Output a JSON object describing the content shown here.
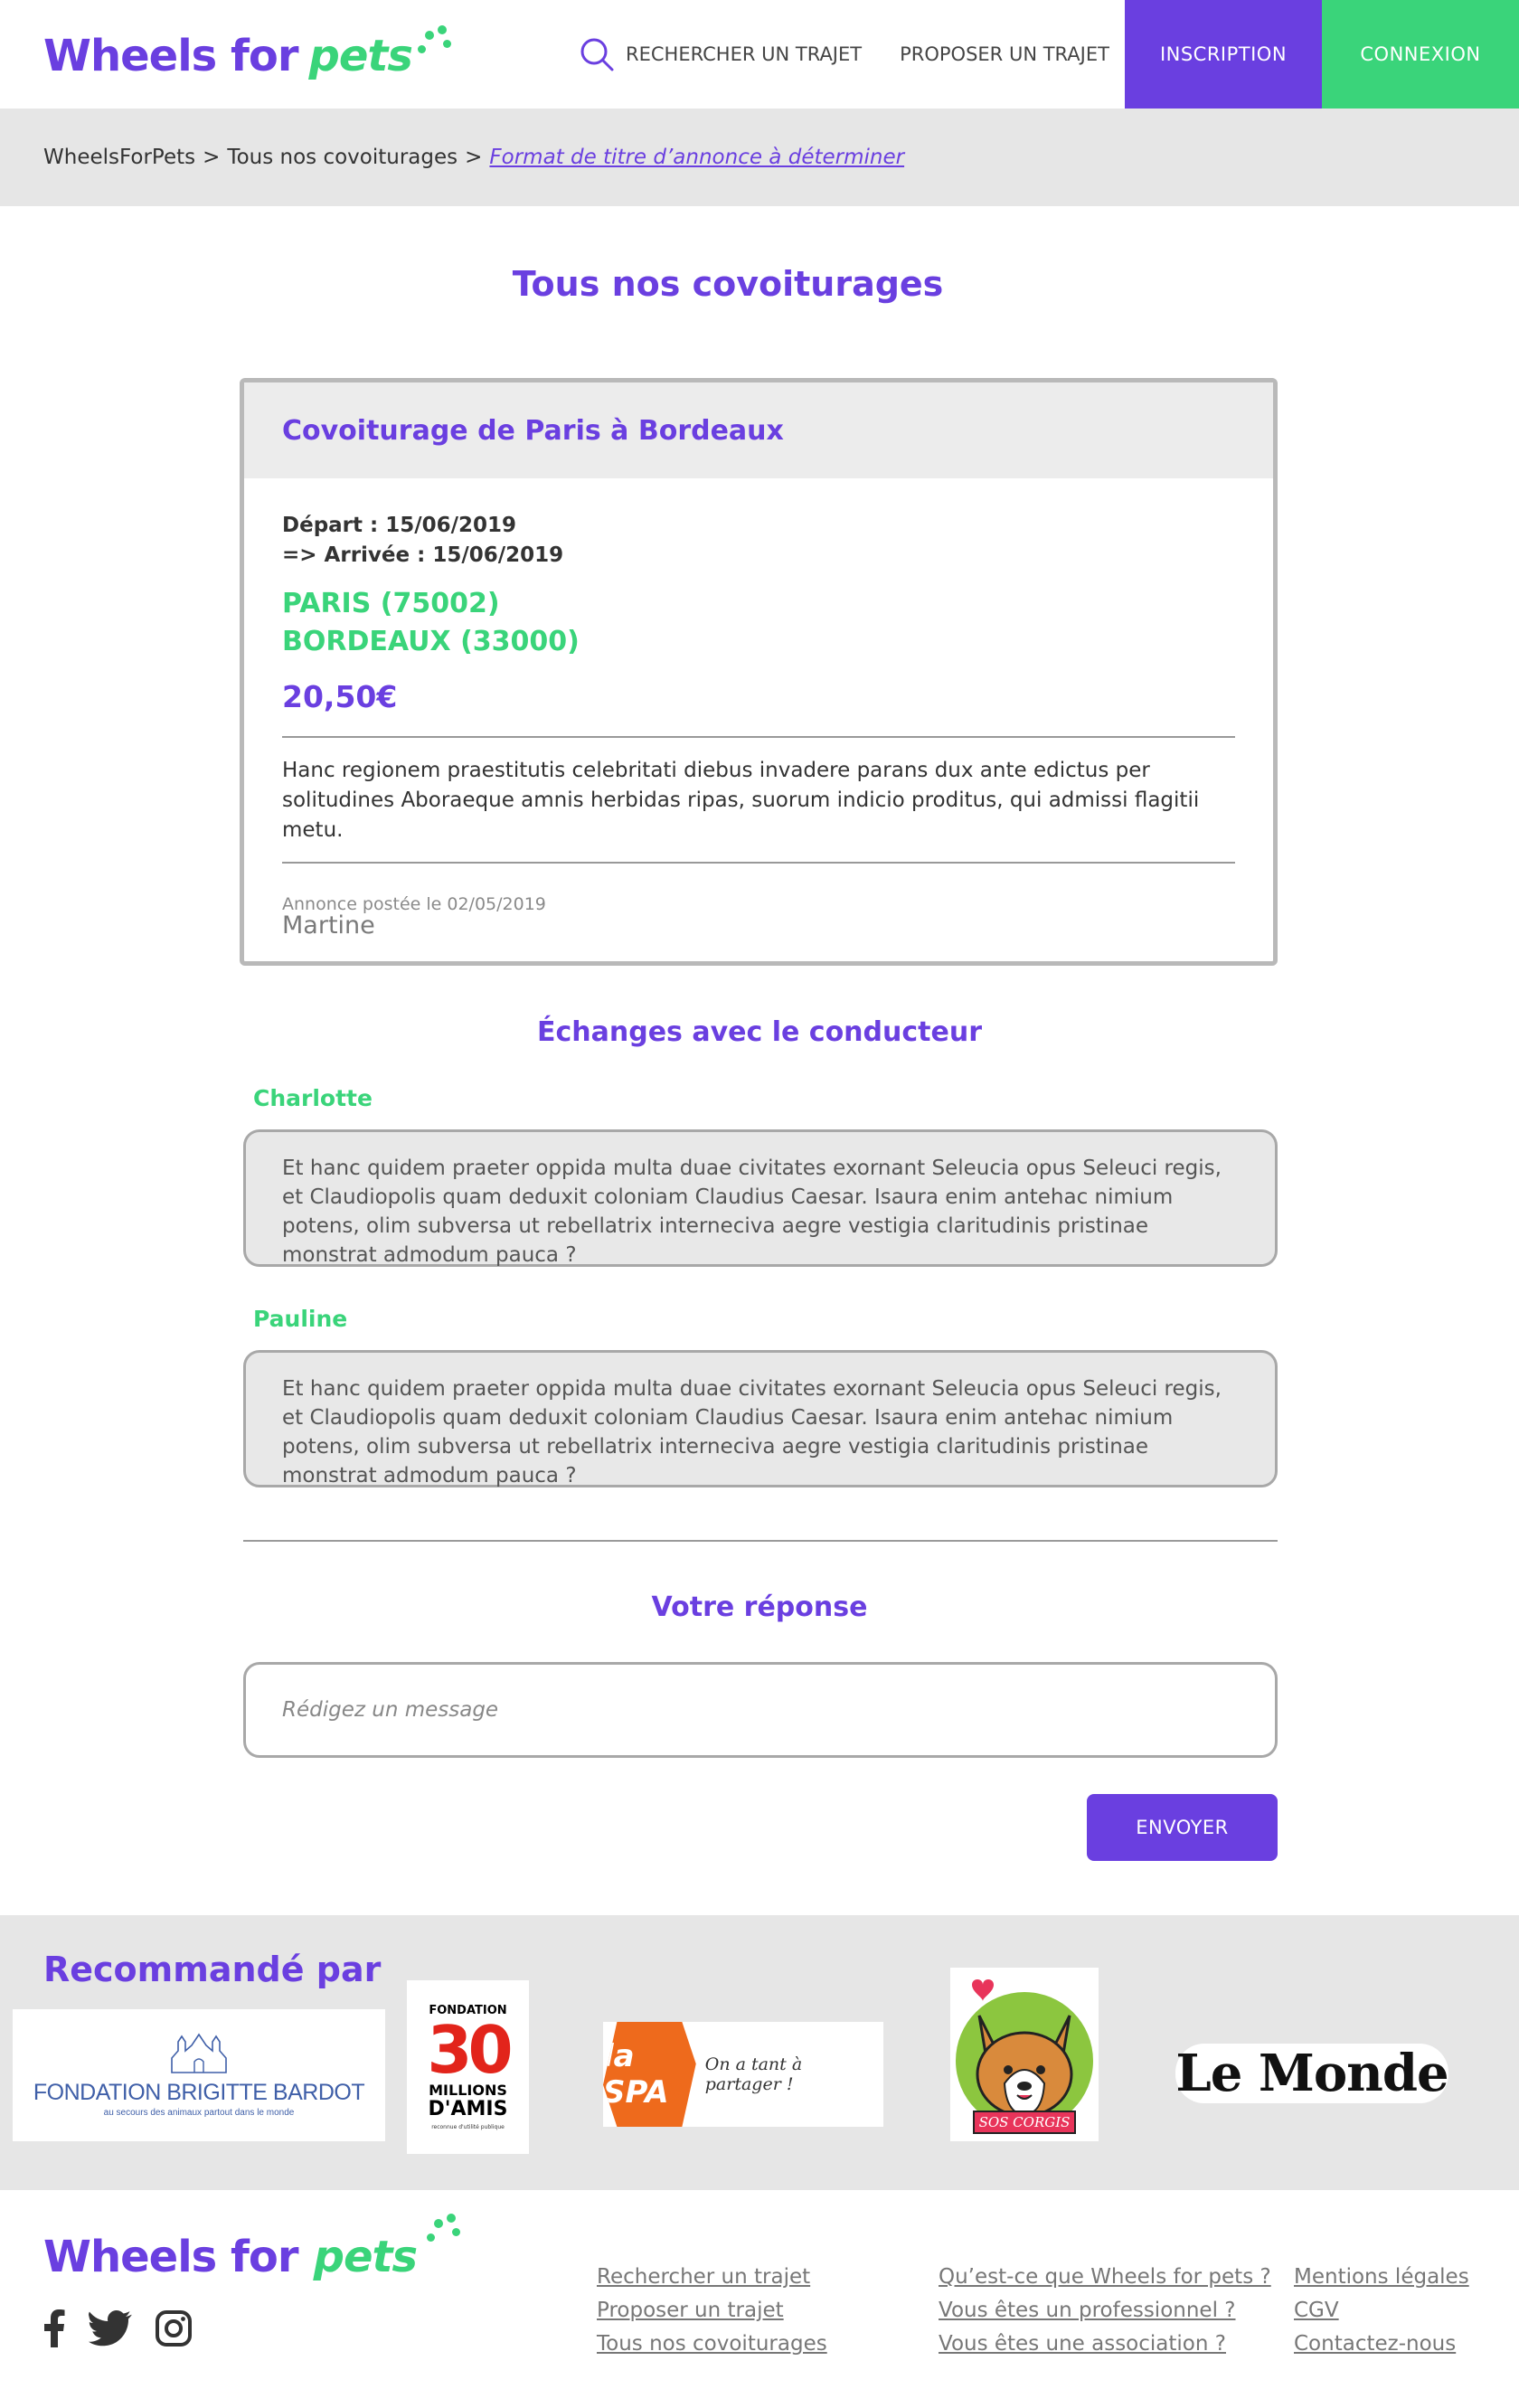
{
  "header": {
    "logo_main": "Wheels for",
    "logo_accent": "pets",
    "nav": {
      "search_label": "RECHERCHER UN TRAJET",
      "propose_label": "PROPOSER UN TRAJET",
      "signup_label": "INSCRIPTION",
      "login_label": "CONNEXION"
    }
  },
  "breadcrumb": {
    "items": [
      "WheelsForPets",
      "Tous nos covoiturages"
    ],
    "separator": ">",
    "current": "Format de titre d’annonce à déterminer"
  },
  "page": {
    "title": "Tous nos covoiturages"
  },
  "ride": {
    "title": "Covoiturage de Paris à Bordeaux",
    "departure": "Départ : 15/06/2019",
    "arrival": "=> Arrivée : 15/06/2019",
    "from_city": "PARIS (75002)",
    "to_city": "BORDEAUX (33000)",
    "price": "20,50€",
    "description": "Hanc regionem praestitutis celebritati diebus invadere parans dux ante edictus per solitudines Aboraeque amnis herbidas ripas, suorum indicio proditus, qui admissi flagitii metu.",
    "posted": "Annonce postée le 02/05/2019",
    "author": "Martine"
  },
  "exchanges": {
    "title": "Échanges avec le conducteur",
    "messages": [
      {
        "author": "Charlotte",
        "text": "Et hanc quidem praeter oppida multa duae civitates exornant Seleucia opus Seleuci regis, et Claudiopolis quam deduxit coloniam Claudius Caesar. Isaura enim antehac nimium potens, olim subversa ut rebellatrix interneciva aegre vestigia claritudinis pristinae monstrat admodum pauca ?"
      },
      {
        "author": "Pauline",
        "text": "Et hanc quidem praeter oppida multa duae civitates exornant Seleucia opus Seleuci regis, et Claudiopolis quam deduxit coloniam Claudius Caesar. Isaura enim antehac nimium potens, olim subversa ut rebellatrix interneciva aegre vestigia claritudinis pristinae monstrat admodum pauca ?"
      }
    ]
  },
  "reply": {
    "title": "Votre réponse",
    "placeholder": "Rédigez un message",
    "send_label": "ENVOYER"
  },
  "partners": {
    "title": "Recommandé par",
    "bardot_line1": "FONDATION BRIGITTE BARDOT",
    "bardot_line2": "au secours des animaux partout dans le monde",
    "fondation30_top": "FONDATION",
    "fondation30_num": "30",
    "fondation30_mid": "MILLIONS",
    "fondation30_bottom": "D'AMIS",
    "fondation30_note": "reconnue d'utilité publique",
    "spa_name": "la SPA",
    "spa_tagline": "On a tant à partager !",
    "sos_corgis": "SOS CORGIS",
    "le_monde": "Le Monde"
  },
  "footer": {
    "logo_main": "Wheels for",
    "logo_accent": "pets",
    "col1": [
      "Rechercher un trajet",
      "Proposer un trajet",
      "Tous nos covoiturages"
    ],
    "col2": [
      "Qu’est-ce que Wheels for pets ?",
      "Vous êtes un professionnel ?",
      "Vous êtes une association ?"
    ],
    "col3": [
      "Mentions légales",
      "CGV",
      "Contactez-nous"
    ]
  },
  "colors": {
    "brand_purple": "#6a3fe0",
    "brand_green": "#3ad47a",
    "grey_band": "#e6e6e6"
  }
}
